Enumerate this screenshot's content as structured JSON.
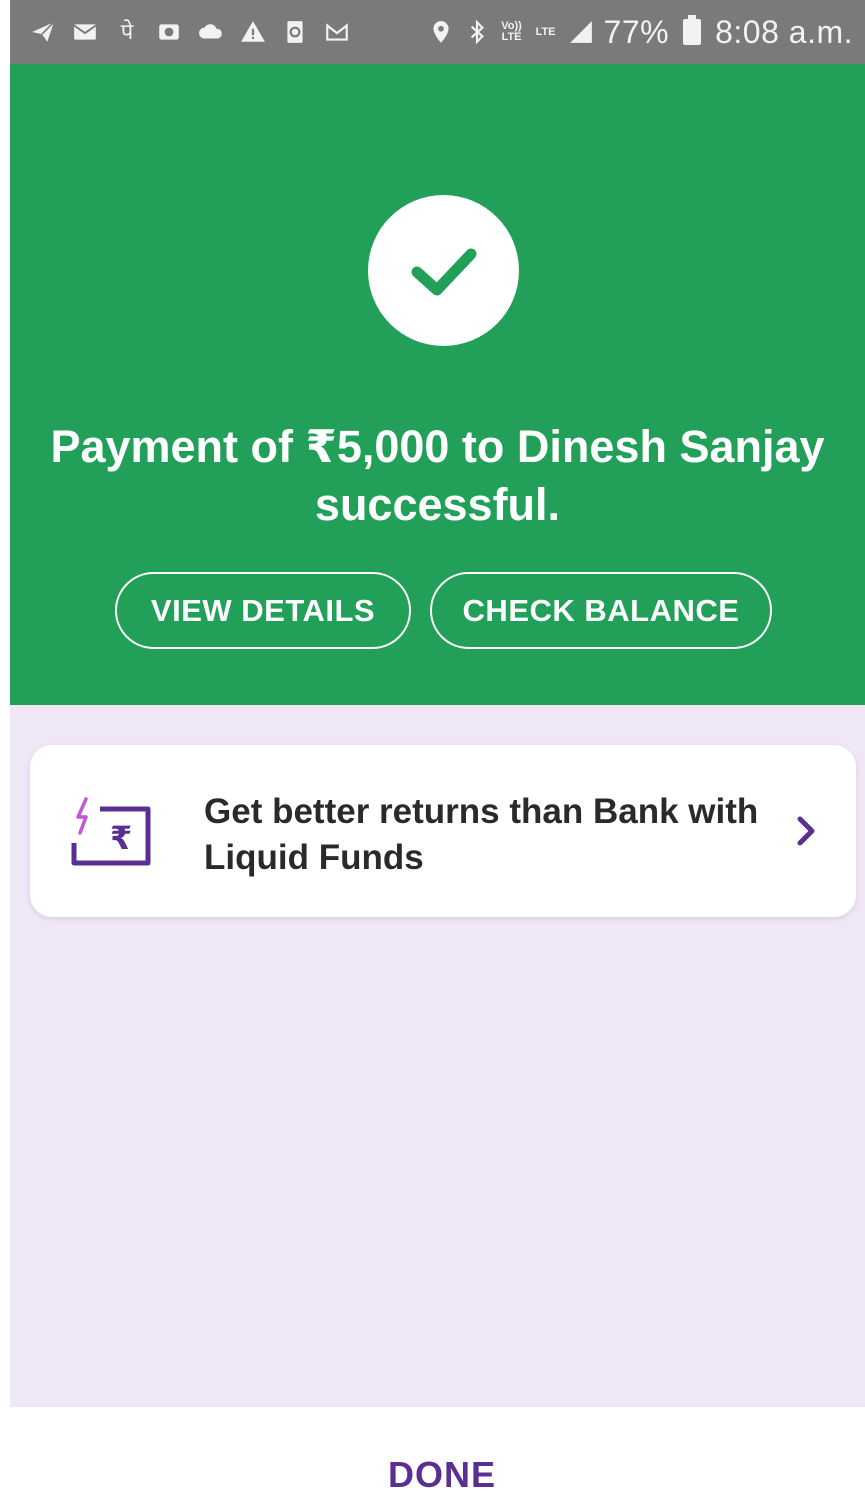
{
  "status_bar": {
    "icons": [
      "telegram-icon",
      "mail-icon",
      "hindi-app-icon",
      "camera-icon",
      "cloud-icon",
      "warning-icon",
      "recycle-icon",
      "gmail-icon",
      "location-icon",
      "bluetooth-icon",
      "volte-icon",
      "lte-icon",
      "signal-icon"
    ],
    "volte_label": "Vo)) LTE",
    "lte_label": "LTE",
    "battery": "77%",
    "time": "8:08 a.m."
  },
  "success": {
    "message": "Payment of ₹5,000 to Dinesh Sanjay successful.",
    "view_details_label": "VIEW DETAILS",
    "check_balance_label": "CHECK BALANCE"
  },
  "promo": {
    "icon": "rupee-card-icon",
    "text": "Get better returns than Bank with Liquid Funds"
  },
  "footer": {
    "done_label": "DONE"
  },
  "colors": {
    "success_green": "#22a05a",
    "background_lavender": "#efe7f6",
    "accent_purple": "#5b2f91",
    "status_bar": "#7a7a7a"
  }
}
